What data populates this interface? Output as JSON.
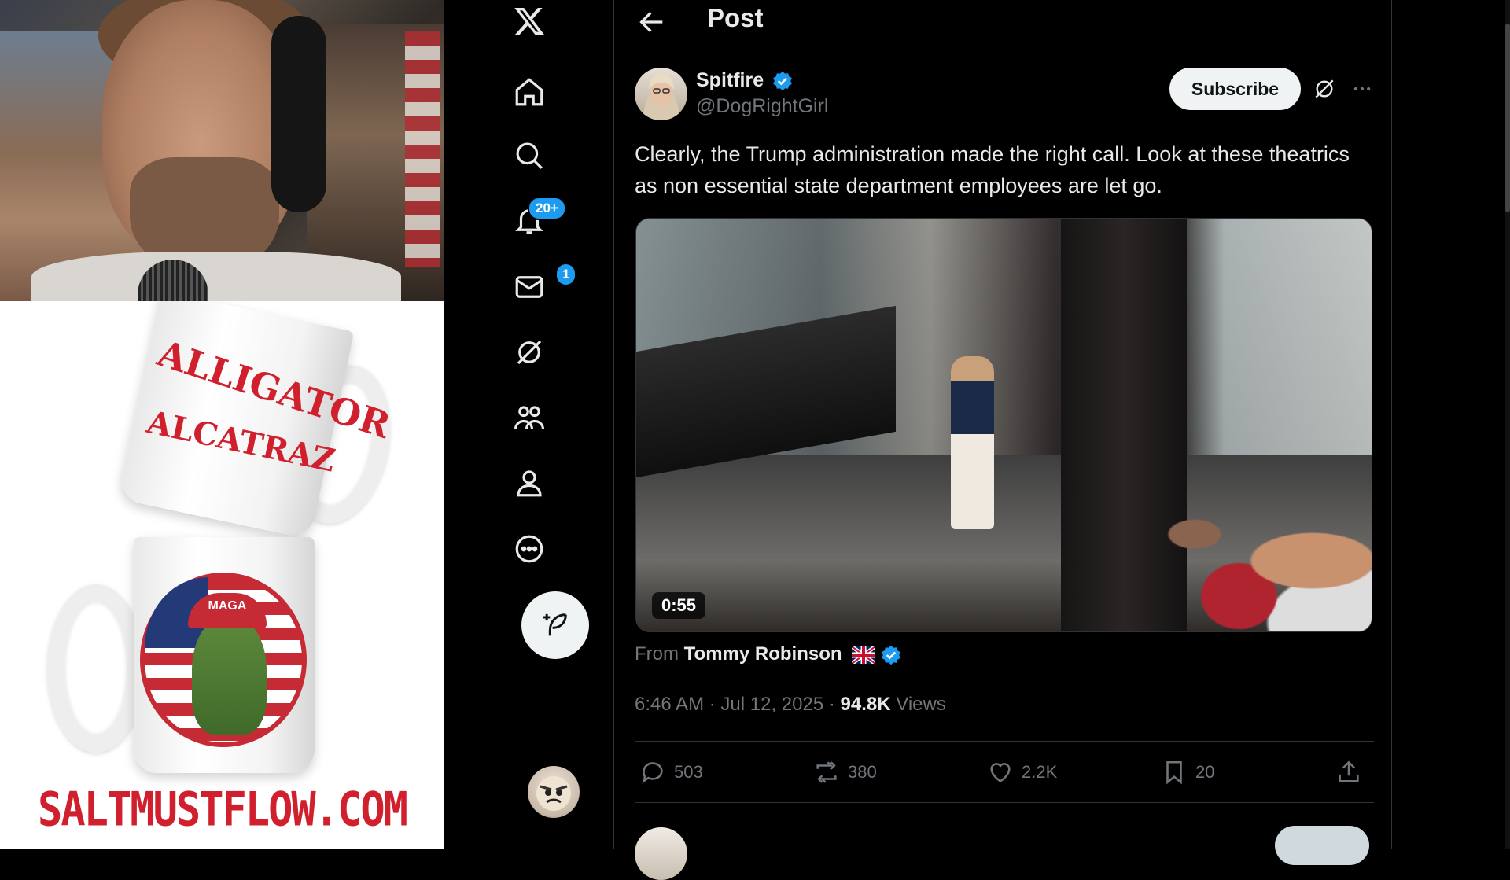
{
  "overlay": {
    "mug_text_line1": "ALLIGATOR",
    "mug_text_line2": "ALCATRAZ",
    "cap_text": "MAGA",
    "site_url": "SALTMUSTFLOW.COM"
  },
  "sidebar": {
    "logo_icon": "x-logo-icon",
    "items": [
      {
        "name": "home",
        "icon": "home-icon"
      },
      {
        "name": "explore",
        "icon": "search-icon"
      },
      {
        "name": "notifications",
        "icon": "bell-icon",
        "badge": "20+"
      },
      {
        "name": "messages",
        "icon": "mail-icon",
        "badge": "1"
      },
      {
        "name": "grok",
        "icon": "grok-icon"
      },
      {
        "name": "communities",
        "icon": "people-icon"
      },
      {
        "name": "profile",
        "icon": "person-icon"
      },
      {
        "name": "more",
        "icon": "more-circle-icon"
      }
    ],
    "compose_icon": "feather-plus-icon"
  },
  "header": {
    "title": "Post"
  },
  "post": {
    "author_name": "Spitfire",
    "author_handle": "@DogRightGirl",
    "subscribe_label": "Subscribe",
    "text": "Clearly, the Trump administration made the right call. Look at these theatrics as non essential state department employees are let go.",
    "media_duration": "0:55",
    "from_prefix": "From",
    "from_name": "Tommy Robinson",
    "time": "6:46 AM",
    "date": "Jul 12, 2025",
    "separator": "·",
    "views_count": "94.8K",
    "views_label": "Views",
    "actions": {
      "replies": "503",
      "reposts": "380",
      "likes": "2.2K",
      "bookmarks": "20"
    }
  },
  "colors": {
    "accent": "#1d9bf0",
    "background": "#000000",
    "text_primary": "#e7e9ea",
    "text_secondary": "#71767b",
    "url_red": "#d0202e"
  }
}
